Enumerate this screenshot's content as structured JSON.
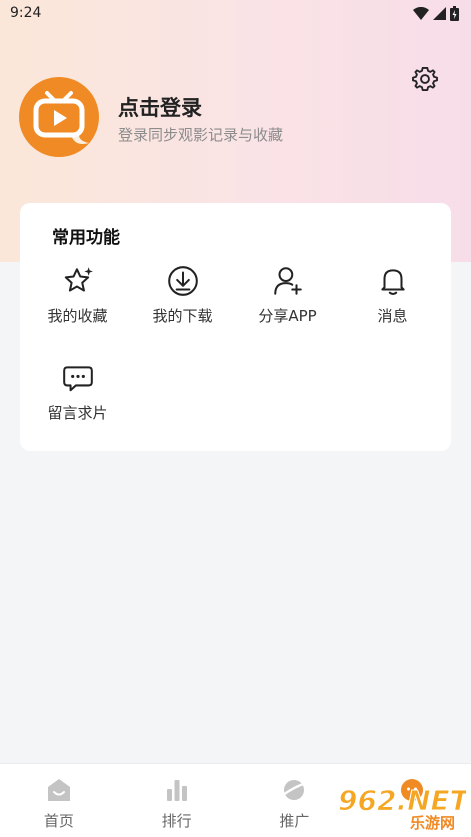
{
  "status_bar": {
    "time": "9:24",
    "icons": [
      "wifi-icon",
      "signal-icon",
      "battery-icon"
    ]
  },
  "profile": {
    "login_title": "点击登录",
    "login_subtitle": "登录同步观影记录与收藏",
    "settings_icon": "gear-icon"
  },
  "common_functions": {
    "title": "常用功能",
    "items": [
      {
        "label": "我的收藏",
        "icon": "star-icon"
      },
      {
        "label": "我的下载",
        "icon": "download-icon"
      },
      {
        "label": "分享APP",
        "icon": "add-user-icon"
      },
      {
        "label": "消息",
        "icon": "bell-icon"
      },
      {
        "label": "留言求片",
        "icon": "message-icon"
      }
    ]
  },
  "tabbar": {
    "tabs": [
      {
        "label": "首页",
        "icon": "home-icon"
      },
      {
        "label": "排行",
        "icon": "rank-icon"
      },
      {
        "label": "推广",
        "icon": "promote-icon"
      },
      {
        "label": "",
        "icon": "profile-icon"
      }
    ]
  },
  "watermark": {
    "text": "962.NET",
    "subtext": "乐游网"
  },
  "colors": {
    "brand_orange": "#f08a24",
    "header_gradient_left": "#fbe7d9",
    "header_gradient_right": "#f7dde8",
    "background": "#f4f5f7"
  }
}
